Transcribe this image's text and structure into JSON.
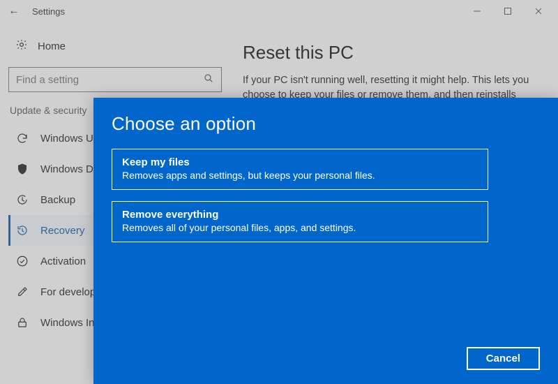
{
  "window": {
    "title": "Settings"
  },
  "sidebar": {
    "home": "Home",
    "search_placeholder": "Find a setting",
    "section": "Update & security",
    "items": [
      {
        "label": "Windows Update"
      },
      {
        "label": "Windows Defender"
      },
      {
        "label": "Backup"
      },
      {
        "label": "Recovery"
      },
      {
        "label": "Activation"
      },
      {
        "label": "For developers"
      },
      {
        "label": "Windows Insider"
      }
    ]
  },
  "main": {
    "heading": "Reset this PC",
    "paragraph": "If your PC isn't running well, resetting it might help. This lets you choose to keep your files or remove them, and then reinstalls Windows."
  },
  "modal": {
    "title": "Choose an option",
    "options": [
      {
        "title": "Keep my files",
        "desc": "Removes apps and settings, but keeps your personal files."
      },
      {
        "title": "Remove everything",
        "desc": "Removes all of your personal files, apps, and settings."
      }
    ],
    "cancel": "Cancel"
  }
}
